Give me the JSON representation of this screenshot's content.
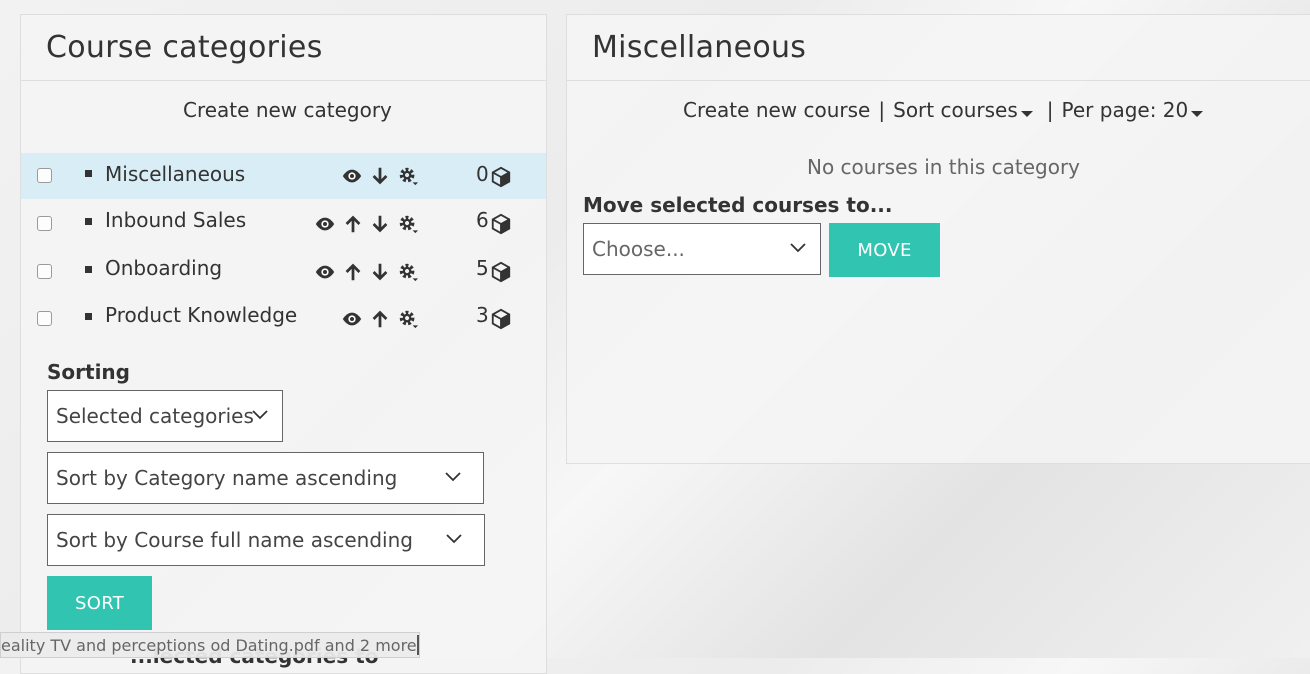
{
  "left_panel": {
    "title": "Course categories",
    "create_label": "Create new category",
    "categories": [
      {
        "name": "Miscellaneous",
        "count": "0"
      },
      {
        "name": "Inbound Sales",
        "count": "6"
      },
      {
        "name": "Onboarding",
        "count": "5"
      },
      {
        "name": "Product Knowledge",
        "count": "3"
      }
    ],
    "sorting_label": "Sorting",
    "scope_select": "Selected categories",
    "category_sort_select": "Sort by Category name ascending",
    "course_sort_select": "Sort by Course full name ascending",
    "sort_button": "SORT",
    "partial_label": "...lected categories to"
  },
  "right_panel": {
    "title": "Miscellaneous",
    "create_course": "Create new course",
    "sort_courses": "Sort courses",
    "per_page": "Per page: 20",
    "separator": "|",
    "empty_message": "No courses in this category",
    "move_label": "Move selected courses to...",
    "choose_select": "Choose...",
    "move_button": "MOVE"
  },
  "tooltip": {
    "text": "eality TV and perceptions od Dating.pdf and 2 more"
  },
  "colors": {
    "accent": "#31c4b1",
    "selected_row": "#d9edf7"
  }
}
